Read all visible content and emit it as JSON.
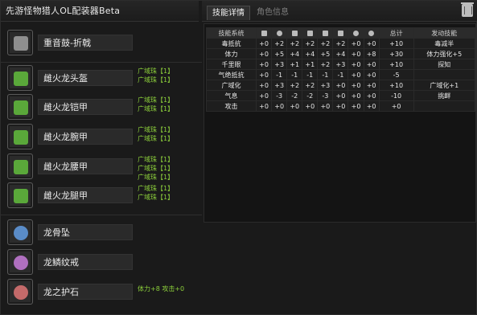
{
  "window": {
    "title": "先游怪物猎人OL配装器Beta"
  },
  "tabs": [
    {
      "label": "技能详情",
      "active": true
    },
    {
      "label": "角色信息",
      "active": false
    }
  ],
  "equipment": [
    {
      "name": "重音鼓-折戟",
      "icon": "weapon-hammer-icon",
      "color": "#8f8f8f",
      "decorations": []
    },
    {
      "name": "雌火龙头盔",
      "icon": "helmet-icon",
      "color": "#5aa83a",
      "decorations": [
        "广域珠【1】",
        "广域珠【1】"
      ]
    },
    {
      "name": "雌火龙铠甲",
      "icon": "chest-armor-icon",
      "color": "#5aa83a",
      "decorations": [
        "广域珠【1】",
        "广域珠【1】"
      ]
    },
    {
      "name": "雌火龙腕甲",
      "icon": "arm-armor-icon",
      "color": "#5aa83a",
      "decorations": [
        "广域珠【1】",
        "广域珠【1】"
      ]
    },
    {
      "name": "雌火龙腰甲",
      "icon": "waist-armor-icon",
      "color": "#5aa83a",
      "decorations": [
        "广域珠【1】",
        "广域珠【1】",
        "广域珠【1】"
      ]
    },
    {
      "name": "雌火龙腿甲",
      "icon": "leg-armor-icon",
      "color": "#5aa83a",
      "decorations": [
        "广域珠【1】",
        "广域珠【1】"
      ]
    },
    {
      "name": "龙骨坠",
      "icon": "pendant-icon",
      "color": "#5a8cc8",
      "decorations": []
    },
    {
      "name": "龙鳞纹戒",
      "icon": "ring-icon",
      "color": "#b070c0",
      "decorations": []
    },
    {
      "name": "龙之护石",
      "icon": "talisman-icon",
      "color": "#c46a6a",
      "decorations": [
        "体力+8 攻击+0"
      ]
    }
  ],
  "skill_table": {
    "headers": [
      "技能系统",
      "",
      "",
      "",
      "",
      "",
      "",
      "",
      "",
      "总计",
      "发动技能"
    ],
    "header_icons": [
      "weapon-icon",
      "helmet-icon",
      "chest-icon",
      "arm-icon",
      "waist-icon",
      "leg-icon",
      "pendant-icon",
      "ring-icon"
    ],
    "rows": [
      {
        "skill": "毒抵抗",
        "values": [
          "+0",
          "+2",
          "+2",
          "+2",
          "+2",
          "+2",
          "+0",
          "+0"
        ],
        "total": "+10",
        "activated": "毒减半"
      },
      {
        "skill": "体力",
        "values": [
          "+0",
          "+5",
          "+4",
          "+4",
          "+5",
          "+4",
          "+0",
          "+8"
        ],
        "total": "+30",
        "activated": "体力强化+5"
      },
      {
        "skill": "千里眼",
        "values": [
          "+0",
          "+3",
          "+1",
          "+1",
          "+2",
          "+3",
          "+0",
          "+0"
        ],
        "total": "+10",
        "activated": "探知"
      },
      {
        "skill": "气绝抵抗",
        "values": [
          "+0",
          "-1",
          "-1",
          "-1",
          "-1",
          "-1",
          "+0",
          "+0"
        ],
        "total": "-5",
        "activated": ""
      },
      {
        "skill": "广域化",
        "values": [
          "+0",
          "+3",
          "+2",
          "+2",
          "+3",
          "+0",
          "+0",
          "+0"
        ],
        "total": "+10",
        "activated": "广域化+1"
      },
      {
        "skill": "气息",
        "values": [
          "+0",
          "-3",
          "-2",
          "-2",
          "-3",
          "+0",
          "+0",
          "+0"
        ],
        "total": "-10",
        "activated": "挑衅"
      },
      {
        "skill": "攻击",
        "values": [
          "+0",
          "+0",
          "+0",
          "+0",
          "+0",
          "+0",
          "+0",
          "+0"
        ],
        "total": "+0",
        "activated": ""
      }
    ]
  }
}
